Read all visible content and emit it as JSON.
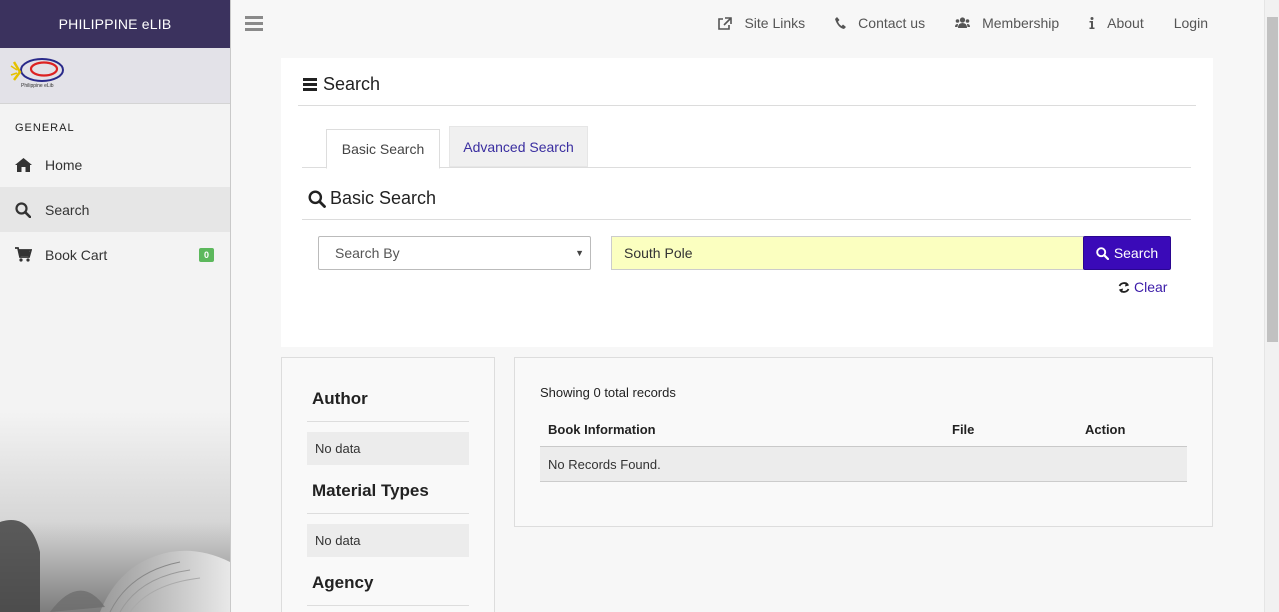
{
  "brand": {
    "title": "PHILIPPINE eLIB",
    "logo_caption": "Philippine eLib"
  },
  "sidebar": {
    "section_label": "GENERAL",
    "items": [
      {
        "label": "Home",
        "icon": "home-icon"
      },
      {
        "label": "Search",
        "icon": "search-icon",
        "active": true
      },
      {
        "label": "Book Cart",
        "icon": "cart-icon",
        "badge": "0"
      }
    ]
  },
  "topnav": {
    "items": [
      {
        "label": "Site Links",
        "icon": "external-link-icon"
      },
      {
        "label": "Contact us",
        "icon": "phone-icon"
      },
      {
        "label": "Membership",
        "icon": "users-icon"
      },
      {
        "label": "About",
        "icon": "info-icon"
      },
      {
        "label": "Login"
      }
    ]
  },
  "search": {
    "panel_title": "Search",
    "tabs": [
      {
        "label": "Basic Search",
        "active": true
      },
      {
        "label": "Advanced Search",
        "active": false
      }
    ],
    "subtitle": "Basic Search",
    "search_by": "Search By",
    "query": "South Pole",
    "search_button": "Search",
    "clear_label": "Clear"
  },
  "filters": [
    {
      "heading": "Author",
      "value": "No data"
    },
    {
      "heading": "Material Types",
      "value": "No data"
    },
    {
      "heading": "Agency"
    }
  ],
  "results": {
    "summary": "Showing 0 total records",
    "columns": [
      "Book Information",
      "File",
      "Action"
    ],
    "empty_message": "No Records Found."
  },
  "colors": {
    "brand_bar": "#3b325e",
    "search_button": "#3a0ab8",
    "input_highlight": "#fbffc0",
    "badge": "#5cb85c",
    "link": "#3a2ea0"
  }
}
